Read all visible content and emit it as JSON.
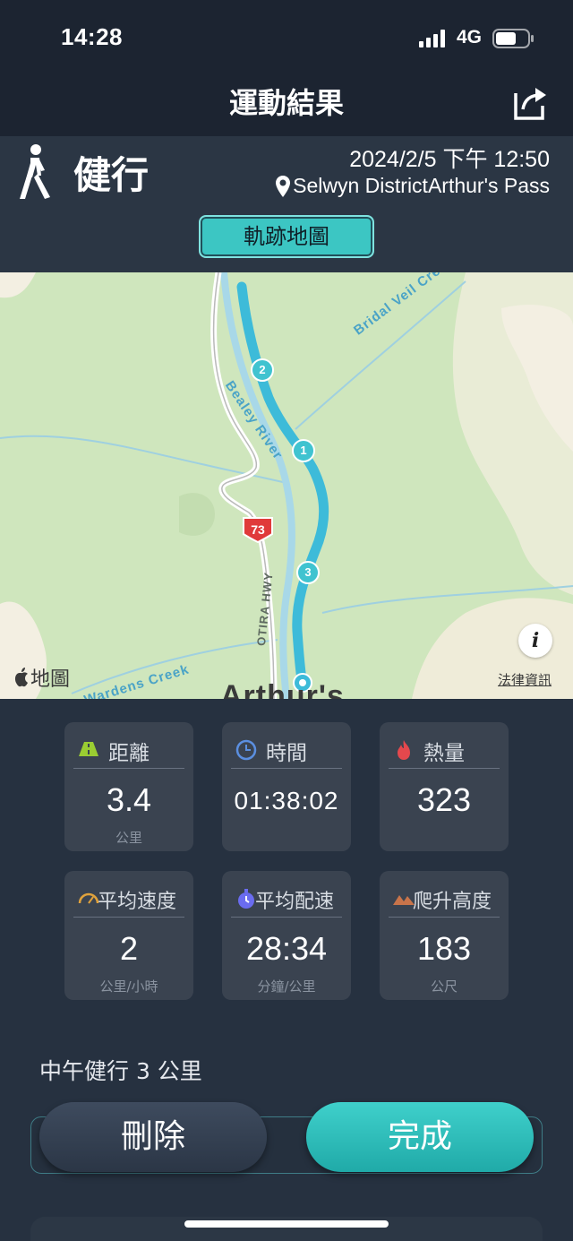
{
  "status": {
    "time": "14:28",
    "network": "4G"
  },
  "nav": {
    "title": "運動結果",
    "share_icon": "share-icon"
  },
  "activity": {
    "type": "健行",
    "date": "2024/2/5 下午 12:50",
    "location": "Selwyn DistrictArthur's Pass",
    "map_tab": "軌跡地圖"
  },
  "map": {
    "labels": {
      "creek_top": "Bridal Veil Creek",
      "river": "Bealey River",
      "highway": "OTIRA HWY",
      "creek_bottom": "Wardens Creek",
      "place": "Arthur's"
    },
    "route_number": "73",
    "markers": [
      "2",
      "1",
      "3"
    ],
    "logo": "地圖",
    "legal": "法律資訊",
    "info": "i"
  },
  "stats": [
    {
      "label": "距離",
      "value": "3.4",
      "unit": "公里",
      "icon": "road-icon",
      "icon_color": "#9acd32"
    },
    {
      "label": "時間",
      "value": "01:38:02",
      "unit": "",
      "icon": "clock-icon",
      "icon_color": "#5b8fe0"
    },
    {
      "label": "熱量",
      "value": "323",
      "unit": "",
      "icon": "flame-icon",
      "icon_color": "#e5484d"
    },
    {
      "label": "平均速度",
      "value": "2",
      "unit": "公里/小時",
      "icon": "speedometer-icon",
      "icon_color": "#e0a23c"
    },
    {
      "label": "平均配速",
      "value": "28:34",
      "unit": "分鐘/公里",
      "icon": "stopwatch-icon",
      "icon_color": "#6a6cf0"
    },
    {
      "label": "爬升高度",
      "value": "183",
      "unit": "公尺",
      "icon": "mountain-icon",
      "icon_color": "#c8744a"
    }
  ],
  "activity_name": "中午健行 3 公里",
  "buttons": {
    "delete": "刪除",
    "done": "完成"
  },
  "colors": {
    "accent": "#3cc6c3",
    "background": "#263140",
    "card": "#3a4350"
  }
}
